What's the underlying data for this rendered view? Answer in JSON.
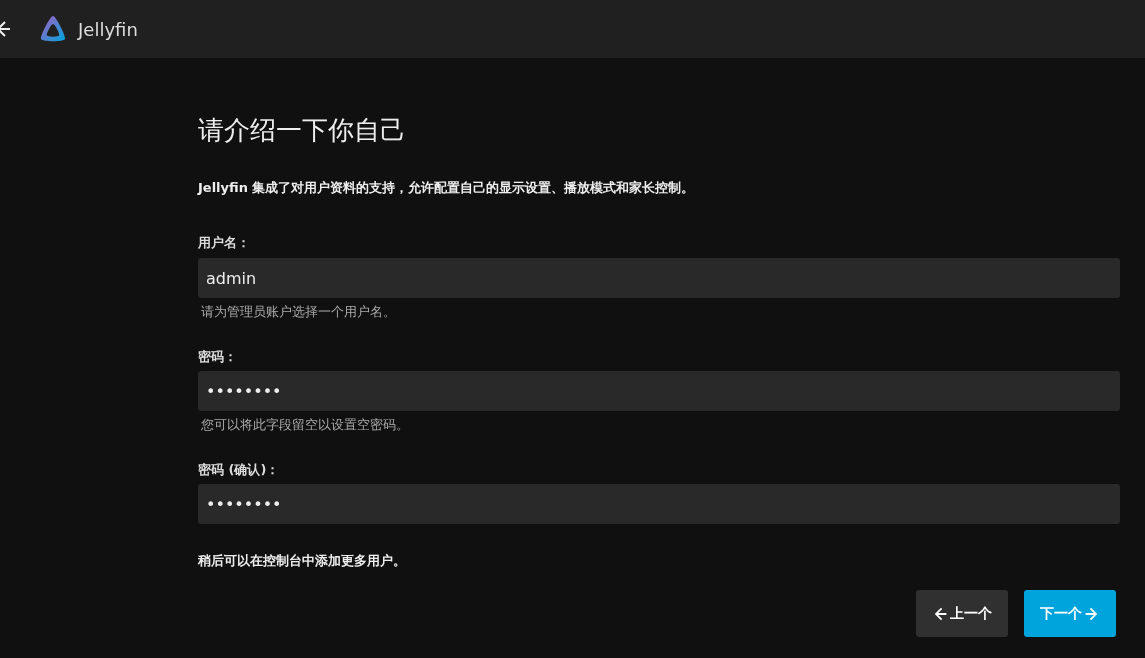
{
  "header": {
    "app_name": "Jellyfin"
  },
  "title": "请介绍一下你自己",
  "description": "Jellyfin 集成了对用户资料的支持，允许配置自己的显示设置、播放模式和家长控制。",
  "fields": [
    {
      "label": "用户名：",
      "value": "admin",
      "hint": "请为管理员账户选择一个用户名。"
    },
    {
      "label": "密码：",
      "value": "••••••••",
      "hint": "您可以将此字段留空以设置空密码。"
    },
    {
      "label": "密码 (确认)：",
      "value": "••••••••"
    }
  ],
  "note": "稍后可以在控制台中添加更多用户。",
  "buttons": [
    {
      "label": "上一个",
      "kind": "back"
    },
    {
      "label": "下一个",
      "kind": "next"
    }
  ]
}
